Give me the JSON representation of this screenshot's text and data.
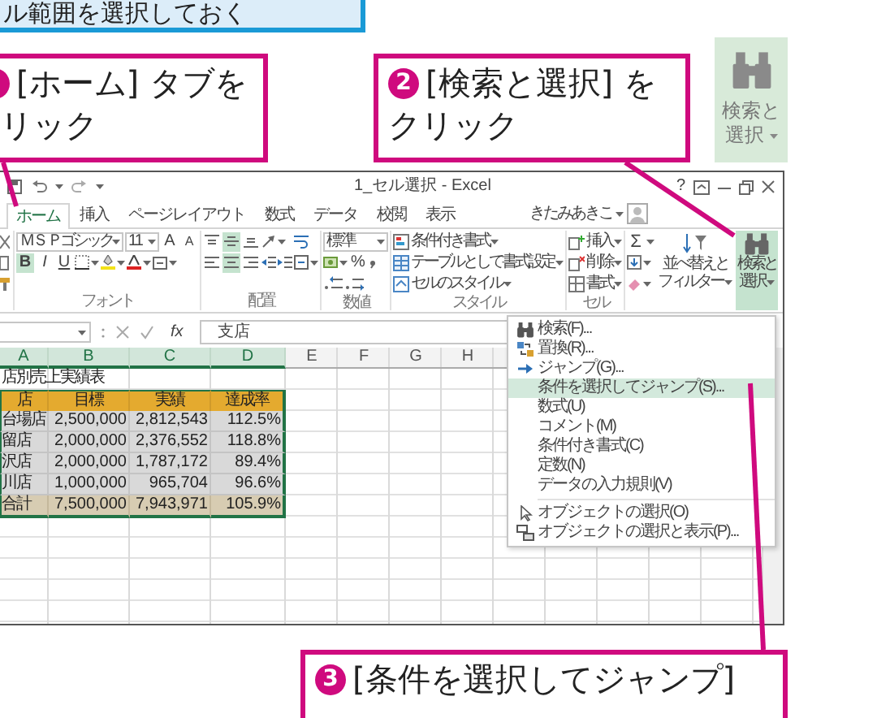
{
  "banner": {
    "text": "ル範囲を選択しておく"
  },
  "callouts": [
    {
      "kind": "cut",
      "lines": [
        "[ホーム] タブを",
        "リック"
      ]
    },
    {
      "kind": "numbered",
      "number": "2",
      "lines": [
        "[検索と選択] を",
        "クリック"
      ]
    },
    {
      "kind": "numbered",
      "number": "3",
      "lines": [
        "[条件を選択してジャンプ]"
      ]
    }
  ],
  "enlarged_button": {
    "lines": [
      "検索と",
      "選択"
    ]
  },
  "excel": {
    "title": "1_セル選択 - Excel",
    "help": "?",
    "tabs": [
      {
        "label": "ホーム",
        "selected": true
      },
      {
        "label": "挿入",
        "selected": false
      },
      {
        "label": "ページレイアウト",
        "selected": false
      },
      {
        "label": "数式",
        "selected": false
      },
      {
        "label": "データ",
        "selected": false
      },
      {
        "label": "校閲",
        "selected": false
      },
      {
        "label": "表示",
        "selected": false
      }
    ],
    "user": "きたみあきこ",
    "font_name": "ＭＳ Ｐゴシック",
    "font_size": "11",
    "font_size_buttons": [
      "A",
      "A"
    ],
    "format_buttons": [
      {
        "label": "B",
        "on": true
      },
      {
        "label": "I",
        "on": false
      },
      {
        "label": "U",
        "on": false
      }
    ],
    "align_buttons": [
      {
        "on": false
      },
      {
        "on": true
      },
      {
        "on": false
      },
      {
        "on": false
      },
      {
        "on": true
      },
      {
        "on": false
      }
    ],
    "number_format": "標準",
    "percent": "%",
    "style_buttons": [
      "条件付き書式",
      "テーブルとして書式設定",
      "セルのスタイル"
    ],
    "cell_buttons": [
      "挿入",
      "削除",
      "書式"
    ],
    "autosum": "Σ",
    "sort_button": [
      "並べ替えと",
      "フィルター"
    ],
    "find_button": {
      "lines": [
        "検索と",
        "選択"
      ],
      "active": true
    },
    "group_labels": [
      "フォント",
      "配置",
      "数値",
      "スタイル",
      "セル"
    ],
    "function_button": "fx",
    "formula": "支店",
    "columns": [
      {
        "label": "A",
        "selected": true
      },
      {
        "label": "B",
        "selected": true
      },
      {
        "label": "C",
        "selected": true
      },
      {
        "label": "D",
        "selected": true
      },
      {
        "label": "E",
        "selected": false
      },
      {
        "label": "F",
        "selected": false
      },
      {
        "label": "G",
        "selected": false
      },
      {
        "label": "H",
        "selected": false
      }
    ],
    "rows": [
      {
        "kind": "title",
        "cells": [
          "店別売上実績表"
        ]
      },
      {
        "kind": "header",
        "cells": [
          "店",
          "目標",
          "実績",
          "達成率"
        ]
      },
      {
        "kind": "data",
        "cells": [
          "台場店",
          "2,500,000",
          "2,812,543",
          "112.5%"
        ]
      },
      {
        "kind": "data",
        "cells": [
          "留店",
          "2,000,000",
          "2,376,552",
          "118.8%"
        ]
      },
      {
        "kind": "data",
        "cells": [
          "沢店",
          "2,000,000",
          "1,787,172",
          "89.4%"
        ]
      },
      {
        "kind": "data",
        "cells": [
          "川店",
          "1,000,000",
          "965,704",
          "96.6%"
        ]
      },
      {
        "kind": "total",
        "cells": [
          "合計",
          "7,500,000",
          "7,943,971",
          "105.9%"
        ]
      }
    ],
    "menu": {
      "sections": [
        {
          "items": [
            {
              "label": "検索(F)...",
              "selected": false
            },
            {
              "label": "置換(R)...",
              "selected": false
            },
            {
              "label": "ジャンプ(G)...",
              "selected": false
            },
            {
              "label": "条件を選択してジャンプ(S)...",
              "selected": true
            },
            {
              "label": "数式(U)",
              "selected": false
            },
            {
              "label": "コメント(M)",
              "selected": false
            },
            {
              "label": "条件付き書式(C)",
              "selected": false
            },
            {
              "label": "定数(N)",
              "selected": false
            },
            {
              "label": "データの入力規則(V)",
              "selected": false
            }
          ]
        },
        {
          "items": [
            {
              "label": "オブジェクトの選択(O)",
              "selected": false
            },
            {
              "label": "オブジェクトの選択と表示(P)...",
              "selected": false
            }
          ]
        }
      ]
    }
  }
}
